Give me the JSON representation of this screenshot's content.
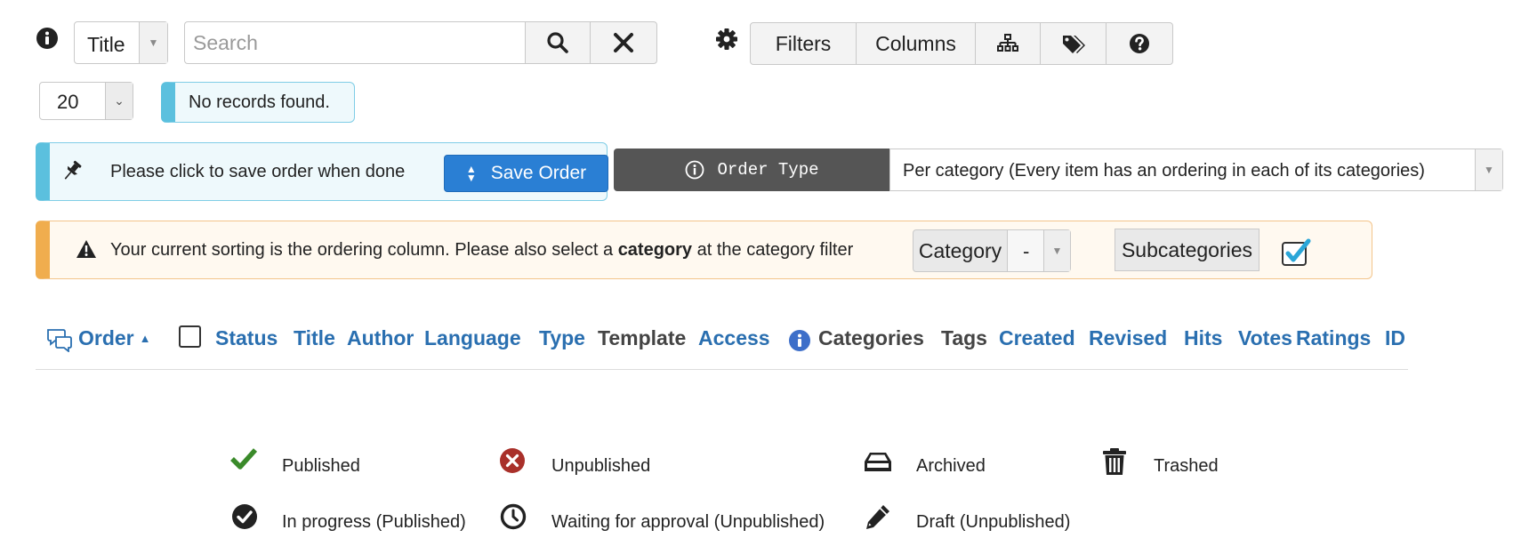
{
  "toolbar": {
    "search_field": {
      "selected": "Title"
    },
    "search": {
      "placeholder": "Search",
      "value": ""
    },
    "buttons": {
      "filters": "Filters",
      "columns": "Columns"
    }
  },
  "pagination": {
    "limit": "20"
  },
  "messages": {
    "no_records": "No records found.",
    "save_hint": "Please click to save order when done",
    "save_order_label": "Save Order",
    "sort_prefix": "Your current sorting is the ordering column. Please also select a ",
    "sort_bold": "category",
    "sort_suffix": " at the category filter"
  },
  "order_type": {
    "label": "Order Type",
    "value": "Per category (Every item has an ordering in each of its categories)"
  },
  "category_filter": {
    "label": "Category",
    "value": "-",
    "subcategories_label": "Subcategories",
    "subcategories_checked": true
  },
  "columns": [
    {
      "label": "Order",
      "sortable": true,
      "sorted": "asc"
    },
    {
      "label": "Status",
      "sortable": true
    },
    {
      "label": "Title",
      "sortable": true
    },
    {
      "label": "Author",
      "sortable": true
    },
    {
      "label": "Language",
      "sortable": true
    },
    {
      "label": "Type",
      "sortable": true
    },
    {
      "label": "Template",
      "sortable": false
    },
    {
      "label": "Access",
      "sortable": true
    },
    {
      "label": "Categories",
      "sortable": false
    },
    {
      "label": "Tags",
      "sortable": false
    },
    {
      "label": "Created",
      "sortable": true
    },
    {
      "label": "Revised",
      "sortable": true
    },
    {
      "label": "Hits",
      "sortable": true
    },
    {
      "label": "Votes",
      "sortable": true
    },
    {
      "label": "Ratings",
      "sortable": true
    },
    {
      "label": "ID",
      "sortable": true
    }
  ],
  "legend": [
    {
      "icon": "check-icon",
      "label": "Published",
      "color": "#3a8a2a"
    },
    {
      "icon": "x-circle-icon",
      "label": "Unpublished",
      "color": "#a9302a"
    },
    {
      "icon": "archive-icon",
      "label": "Archived",
      "color": "#222222"
    },
    {
      "icon": "trash-icon",
      "label": "Trashed",
      "color": "#222222"
    },
    {
      "icon": "check-circle-icon",
      "label": "In progress (Published)",
      "color": "#222222"
    },
    {
      "icon": "clock-icon",
      "label": "Waiting for approval (Unpublished)",
      "color": "#222222"
    },
    {
      "icon": "pencil-icon",
      "label": "Draft (Unpublished)",
      "color": "#222222"
    }
  ],
  "colors": {
    "link": "#2a6fb0",
    "info_bar": "#5bc0de",
    "warning_bar": "#f0ad4e",
    "primary_button": "#2a7fd4",
    "dark_label": "#555555",
    "info_icon_blue": "#3d6fc9"
  }
}
